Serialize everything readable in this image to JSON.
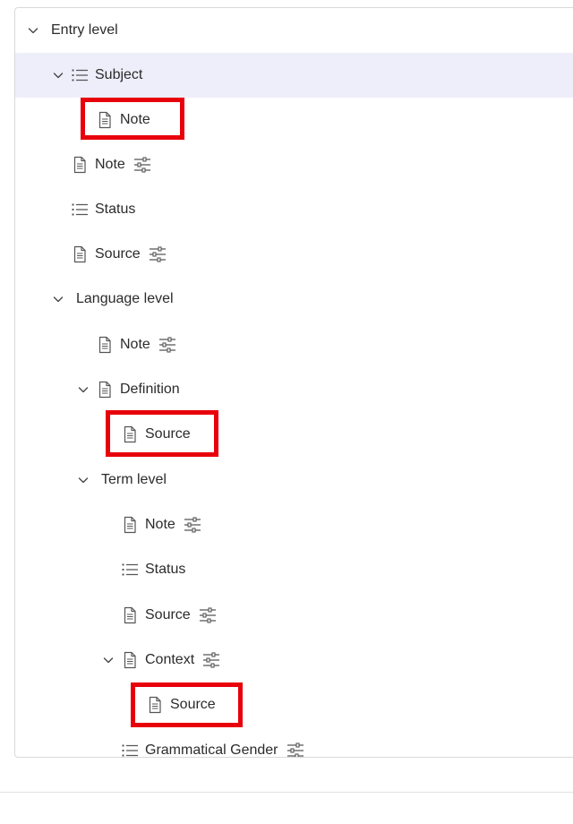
{
  "tree": {
    "entry_level": "Entry level",
    "entry_subject": "Subject",
    "entry_subject_note": "Note",
    "entry_note": "Note",
    "entry_status": "Status",
    "entry_source": "Source",
    "language_level": "Language level",
    "language_note": "Note",
    "language_definition": "Definition",
    "language_definition_source": "Source",
    "term_level": "Term level",
    "term_note": "Note",
    "term_status": "Status",
    "term_source": "Source",
    "term_context": "Context",
    "term_context_source": "Source",
    "term_grammatical_gender": "Grammatical Gender"
  },
  "highlight_color": "#e8000b",
  "selected_row": "Subject"
}
